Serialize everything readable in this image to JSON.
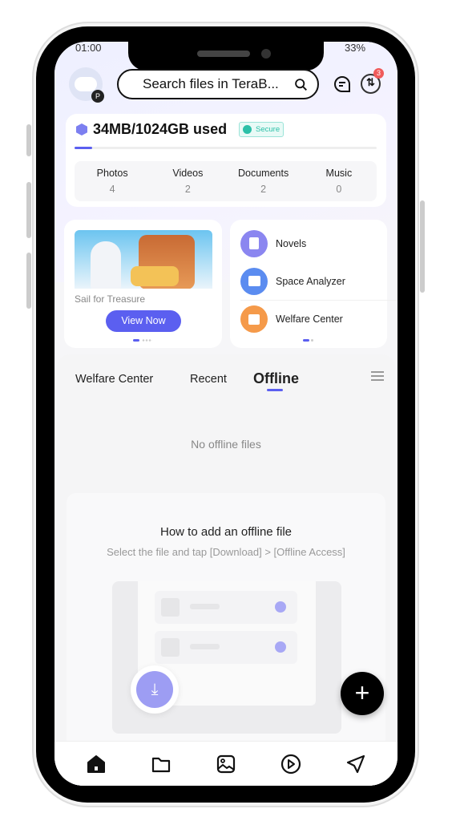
{
  "status": {
    "time": "01:00",
    "battery": "33%"
  },
  "header": {
    "search_placeholder": "Search files in TeraB...",
    "notification_count": "3",
    "avatar_badge": "P"
  },
  "storage": {
    "used_label": "34MB/1024GB used",
    "secure_label": "Secure",
    "used_fraction": 3e-05,
    "accent": "#5b5ff0"
  },
  "categories": [
    {
      "label": "Photos",
      "count": "4"
    },
    {
      "label": "Videos",
      "count": "2"
    },
    {
      "label": "Documents",
      "count": "2"
    },
    {
      "label": "Music",
      "count": "0"
    }
  ],
  "promo": {
    "title": "Sail for Treasure",
    "button": "View Now"
  },
  "tools": [
    {
      "label": "Novels",
      "icon": "book-icon",
      "color": "#8b86f0"
    },
    {
      "label": "Space Analyzer",
      "icon": "chart-icon",
      "color": "#5b8cf0"
    },
    {
      "label": "Welfare Center",
      "icon": "gift-icon",
      "color": "#f59a4a"
    }
  ],
  "tabs": [
    {
      "label": "Welfare Center"
    },
    {
      "label": "Recent"
    },
    {
      "label": "Offline",
      "active": true
    }
  ],
  "offline": {
    "empty": "No offline files",
    "how_title": "How to add an offline file",
    "how_desc": "Select the file and tap [Download] > [Offline Access]"
  },
  "nav": [
    {
      "icon": "home-icon",
      "active": true
    },
    {
      "icon": "folder-icon"
    },
    {
      "icon": "image-icon"
    },
    {
      "icon": "play-icon"
    },
    {
      "icon": "send-icon"
    }
  ]
}
